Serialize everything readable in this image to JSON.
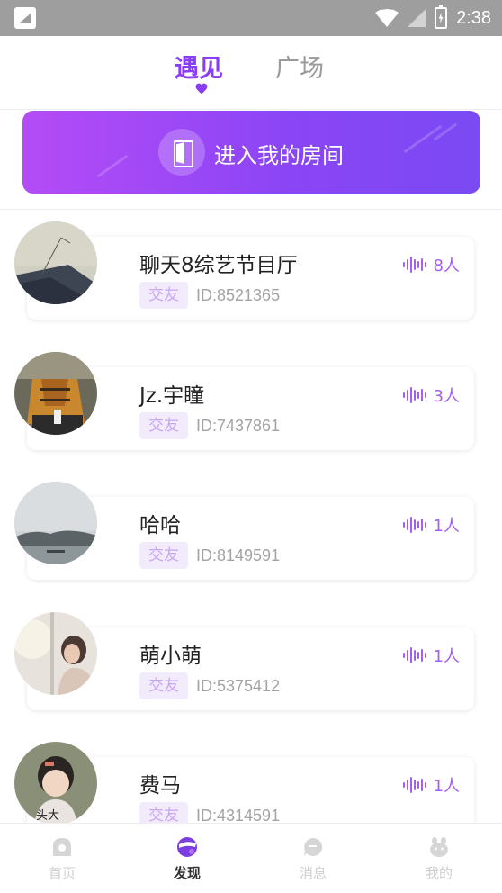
{
  "status_bar": {
    "time": "2:38"
  },
  "header": {
    "tabs": [
      {
        "label": "遇见",
        "active": true
      },
      {
        "label": "广场",
        "active": false
      }
    ]
  },
  "banner": {
    "label": "进入我的房间"
  },
  "rooms": [
    {
      "name": "聊天8综艺节目厅",
      "tag": "交友",
      "id": "ID:8521365",
      "count": "8人"
    },
    {
      "name": "Jz.宇瞳",
      "tag": "交友",
      "id": "ID:7437861",
      "count": "3人"
    },
    {
      "name": "哈哈",
      "tag": "交友",
      "id": "ID:8149591",
      "count": "1人"
    },
    {
      "name": "萌小萌",
      "tag": "交友",
      "id": "ID:5375412",
      "count": "1人"
    },
    {
      "name": "费马",
      "tag": "交友",
      "id": "ID:4314591",
      "count": "1人",
      "avatar_text": "头大"
    }
  ],
  "bottom_nav": [
    {
      "label": "首页",
      "icon": "home-icon",
      "active": false
    },
    {
      "label": "发现",
      "icon": "discover-icon",
      "active": true
    },
    {
      "label": "消息",
      "icon": "message-icon",
      "active": false
    },
    {
      "label": "我的",
      "icon": "profile-icon",
      "active": false
    }
  ],
  "colors": {
    "accent": "#8b3cf7",
    "banner_start": "#b44cf6",
    "banner_end": "#7a4af3",
    "tag_bg": "#f1ebfc",
    "tag_text": "#c9a7f2",
    "count": "#a45ef2",
    "status_bar": "#9e9e9e"
  }
}
